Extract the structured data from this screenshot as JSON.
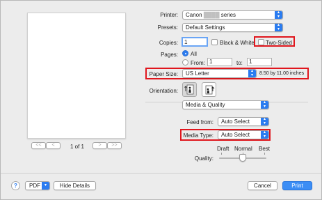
{
  "preview": {
    "page_count": "1 of 1",
    "first_glyph": "<<",
    "prev_glyph": "<",
    "next_glyph": ">",
    "last_glyph": ">>"
  },
  "printer": {
    "label": "Printer:",
    "value": "Canon",
    "redacted": "████",
    "suffix": "series"
  },
  "presets": {
    "label": "Presets:",
    "value": "Default Settings"
  },
  "copies": {
    "label": "Copies:",
    "value": "1"
  },
  "black_white": {
    "label": "Black & White",
    "checked": false
  },
  "two_sided": {
    "label": "Two-Sided",
    "checked": false
  },
  "pages": {
    "label": "Pages:",
    "all_label": "All",
    "from_label": "From:",
    "from_value": "1",
    "to_label": "to:",
    "to_value": "1"
  },
  "paper_size": {
    "label": "Paper Size:",
    "value": "US Letter",
    "dimensions": "8.50 by 11.00 inches"
  },
  "orientation": {
    "label": "Orientation:"
  },
  "section": {
    "value": "Media & Quality"
  },
  "feed_from": {
    "label": "Feed from:",
    "value": "Auto Select"
  },
  "media_type": {
    "label": "Media Type:",
    "value": "Auto Select"
  },
  "quality": {
    "label": "Quality:",
    "draft": "Draft",
    "normal": "Normal",
    "best": "Best",
    "level": 0.5
  },
  "bottom": {
    "help": "?",
    "pdf": "PDF",
    "hide_details": "Hide Details",
    "cancel": "Cancel",
    "print": "Print"
  },
  "colors": {
    "accent": "#2b7cf0",
    "highlight": "#e0161d"
  }
}
